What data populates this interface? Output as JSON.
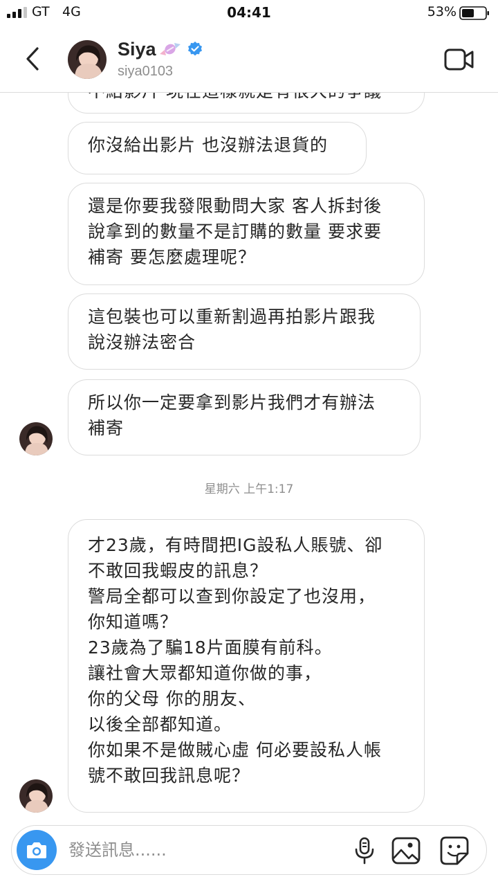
{
  "status_bar": {
    "carrier": "GT",
    "network": "4G",
    "time": "04:41",
    "battery_percent": "53%",
    "battery_level": 0.53,
    "signal_bars": 3
  },
  "header": {
    "name": "Siya",
    "username": "siya0103",
    "name_emoji": "candy-icon",
    "verified": true,
    "accent_color": "#3897f0"
  },
  "messages": [
    {
      "text": "不給影片 現在這樣就是有很大的爭議"
    },
    {
      "text": "你沒給出影片 也沒辦法退貨的"
    },
    {
      "text": "還是你要我發限動問大家 客人拆封後\n說拿到的數量不是訂購的數量 要求要\n補寄 要怎麼處理呢？"
    },
    {
      "text": "這包裝也可以重新割過再拍影片跟我\n說沒辦法密合"
    },
    {
      "text": "所以你一定要拿到影片我們才有辦法\n補寄"
    }
  ],
  "timestamp": "星期六 上午1:17",
  "last_message": {
    "text": "才23歲，有時間把IG設私人賬號、卻\n不敢回我蝦皮的訊息？\n警局全都可以查到你設定了也沒用，\n你知道嗎？\n23歲為了騙18片面膜有前科。\n讓社會大眾都知道你做的事，\n你的父母 你的朋友、\n以後全部都知道。\n你如果不是做賊心虛 何必要設私人帳\n號不敢回我訊息呢？"
  },
  "composer": {
    "placeholder": "發送訊息......",
    "icons": [
      "camera-icon",
      "microphone-icon",
      "gallery-icon",
      "sticker-icon"
    ]
  }
}
